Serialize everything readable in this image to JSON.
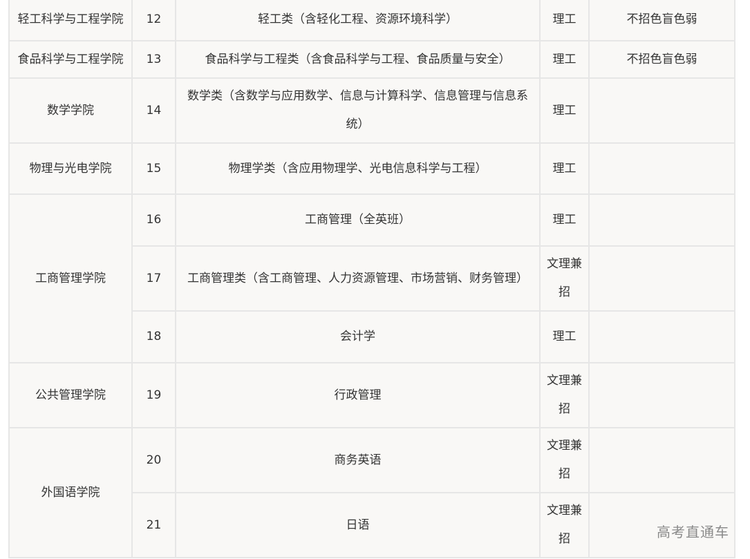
{
  "rows": [
    {
      "college": "轻工科学与工程学院",
      "num": "12",
      "major": "轻工类（含轻化工程、资源环境科学）",
      "category": "理工",
      "note": "不招色盲色弱"
    },
    {
      "college": "食品科学与工程学院",
      "num": "13",
      "major": "食品科学与工程类（含食品科学与工程、食品质量与安全）",
      "category": "理工",
      "note": "不招色盲色弱"
    },
    {
      "college": "数学学院",
      "num": "14",
      "major": "数学类（含数学与应用数学、信息与计算科学、信息管理与信息系统）",
      "category": "理工",
      "note": ""
    },
    {
      "college": "物理与光电学院",
      "num": "15",
      "major": "物理学类（含应用物理学、光电信息科学与工程）",
      "category": "理工",
      "note": ""
    },
    {
      "college": "工商管理学院",
      "num": "16",
      "major": "工商管理（全英班）",
      "category": "理工",
      "note": ""
    },
    {
      "college": "",
      "num": "17",
      "major": "工商管理类（含工商管理、人力资源管理、市场营销、财务管理）",
      "category": "文理兼招",
      "note": ""
    },
    {
      "college": "",
      "num": "18",
      "major": "会计学",
      "category": "理工",
      "note": ""
    },
    {
      "college": "公共管理学院",
      "num": "19",
      "major": "行政管理",
      "category": "文理兼招",
      "note": ""
    },
    {
      "college": "外国语学院",
      "num": "20",
      "major": "商务英语",
      "category": "文理兼招",
      "note": ""
    },
    {
      "college": "",
      "num": "21",
      "major": "日语",
      "category": "文理兼招",
      "note": ""
    }
  ],
  "watermark": "高考直通车"
}
